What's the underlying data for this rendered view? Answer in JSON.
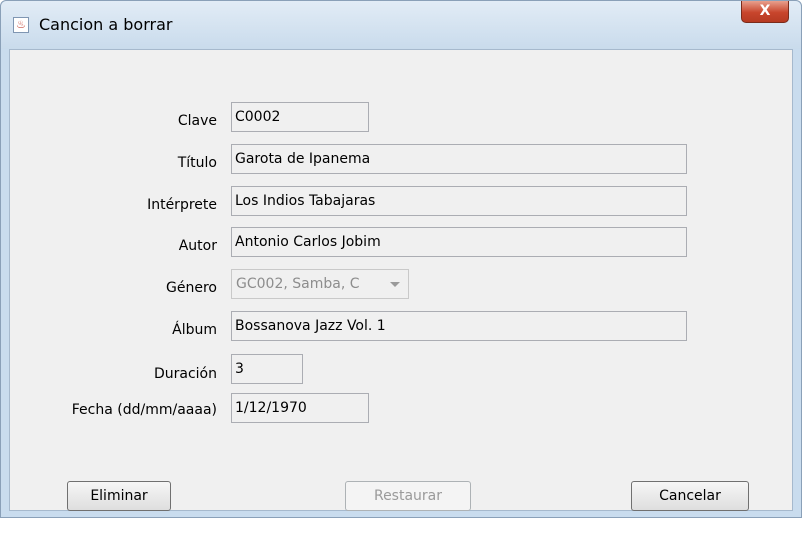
{
  "window": {
    "title": "Cancion a borrar",
    "close_label": "X"
  },
  "form": {
    "clave": {
      "label": "Clave",
      "value": "C0002"
    },
    "titulo": {
      "label": "Título",
      "value": "Garota de Ipanema"
    },
    "interprete": {
      "label": "Intérprete",
      "value": "Los Indios Tabajaras"
    },
    "autor": {
      "label": "Autor",
      "value": "Antonio Carlos Jobim"
    },
    "genero": {
      "label": "Género",
      "value": "GC002, Samba, C"
    },
    "album": {
      "label": "Álbum",
      "value": "Bossanova Jazz Vol. 1"
    },
    "duracion": {
      "label": "Duración",
      "value": "3"
    },
    "fecha": {
      "label": "Fecha (dd/mm/aaaa)",
      "value": "1/12/1970"
    }
  },
  "buttons": {
    "eliminar": "Eliminar",
    "restaurar": "Restaurar",
    "cancelar": "Cancelar"
  }
}
